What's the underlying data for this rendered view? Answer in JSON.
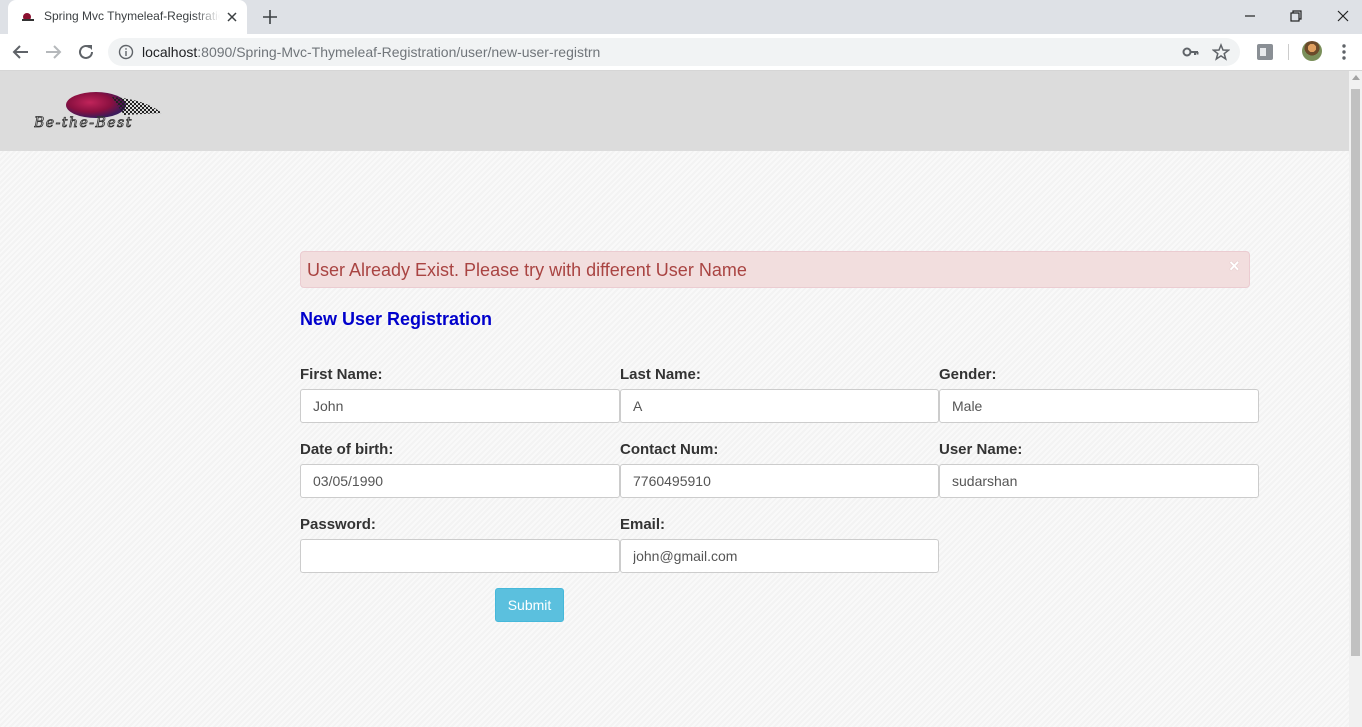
{
  "browser": {
    "tab_title": "Spring Mvc Thymeleaf-Registration",
    "url_host": "localhost",
    "url_rest": ":8090/Spring-Mvc-Thymeleaf-Registration/user/new-user-registrn"
  },
  "header": {
    "logo_text": "Be-the-Best"
  },
  "alert": {
    "message": "User Already Exist. Please try with different User Name",
    "close": "×"
  },
  "form": {
    "title": "New User Registration",
    "fields": {
      "first_name": {
        "label": "First Name:",
        "value": "John"
      },
      "last_name": {
        "label": "Last Name:",
        "value": "A"
      },
      "gender": {
        "label": "Gender:",
        "value": "Male"
      },
      "dob": {
        "label": "Date of birth:",
        "value": "03/05/1990"
      },
      "contact": {
        "label": "Contact Num:",
        "value": "7760495910"
      },
      "username": {
        "label": "User Name:",
        "value": "sudarshan"
      },
      "password": {
        "label": "Password:",
        "value": ""
      },
      "email": {
        "label": "Email:",
        "value": "john@gmail.com"
      }
    },
    "submit_label": "Submit"
  },
  "colors": {
    "heading": "#0000cc",
    "alert_bg": "#f2dede",
    "alert_text": "#a94442",
    "submit_bg": "#5bc0de"
  }
}
